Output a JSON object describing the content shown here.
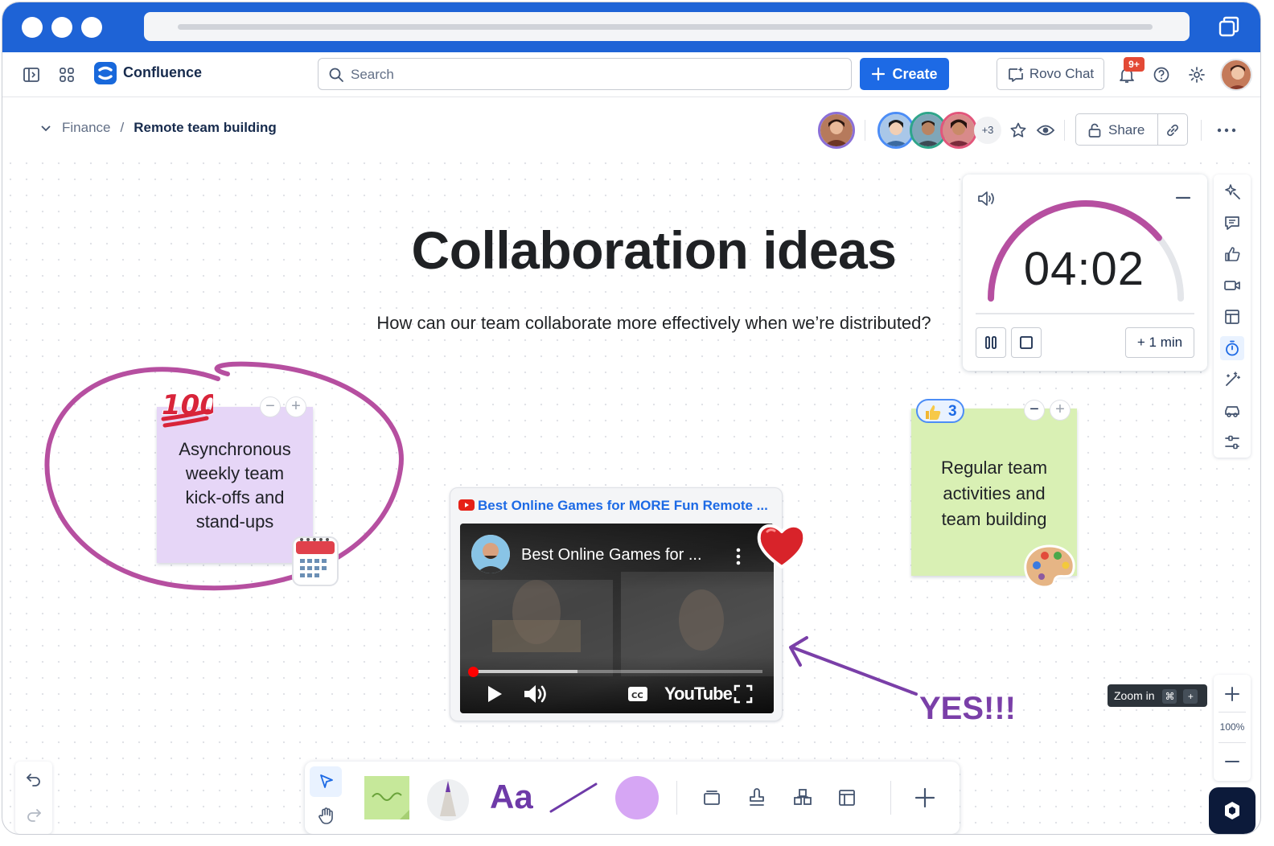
{
  "header": {
    "brand": "Confluence",
    "search_placeholder": "Search",
    "create_label": "Create",
    "rovo_label": "Rovo Chat",
    "notification_count": "9+"
  },
  "page": {
    "breadcrumb_parent": "Finance",
    "breadcrumb_separator": "/",
    "breadcrumb_current": "Remote team building",
    "extra_viewers": "+3",
    "share_label": "Share"
  },
  "whiteboard": {
    "title": "Collaboration ideas",
    "subtitle": "How can our team collaborate more effectively when we’re distributed?",
    "sticky_purple": {
      "lines": [
        "Asynchronous",
        "weekly team",
        "kick-offs and",
        "stand-ups"
      ],
      "color": "#e6d6f7"
    },
    "sticky_green": {
      "lines": [
        "Regular team",
        "activities and",
        "team building"
      ],
      "color": "#d9f0b4",
      "reaction_count": "3"
    },
    "video": {
      "link_title": "Best Online Games for MORE Fun Remote ...",
      "player_title": "Best Online Games for ...",
      "brand": "YouTube"
    },
    "annotation": "YES!!!"
  },
  "timer": {
    "time": "04:02",
    "add_label": "+ 1 min",
    "progress_fraction": 0.78,
    "accent": "#b64fa0"
  },
  "zoom": {
    "tooltip": "Zoom in",
    "shortcut_keys": [
      "⌘",
      "+"
    ],
    "level": "100%"
  },
  "toolbar": {
    "text_tool": "Aa",
    "shape_color": "#d6a6f4",
    "sticky_color": "#c6e89a"
  },
  "colors": {
    "primary": "#1d6ae5",
    "titlebar": "#1e63d6",
    "ink": "#b64fa0",
    "purple_text": "#7a3fa8"
  }
}
